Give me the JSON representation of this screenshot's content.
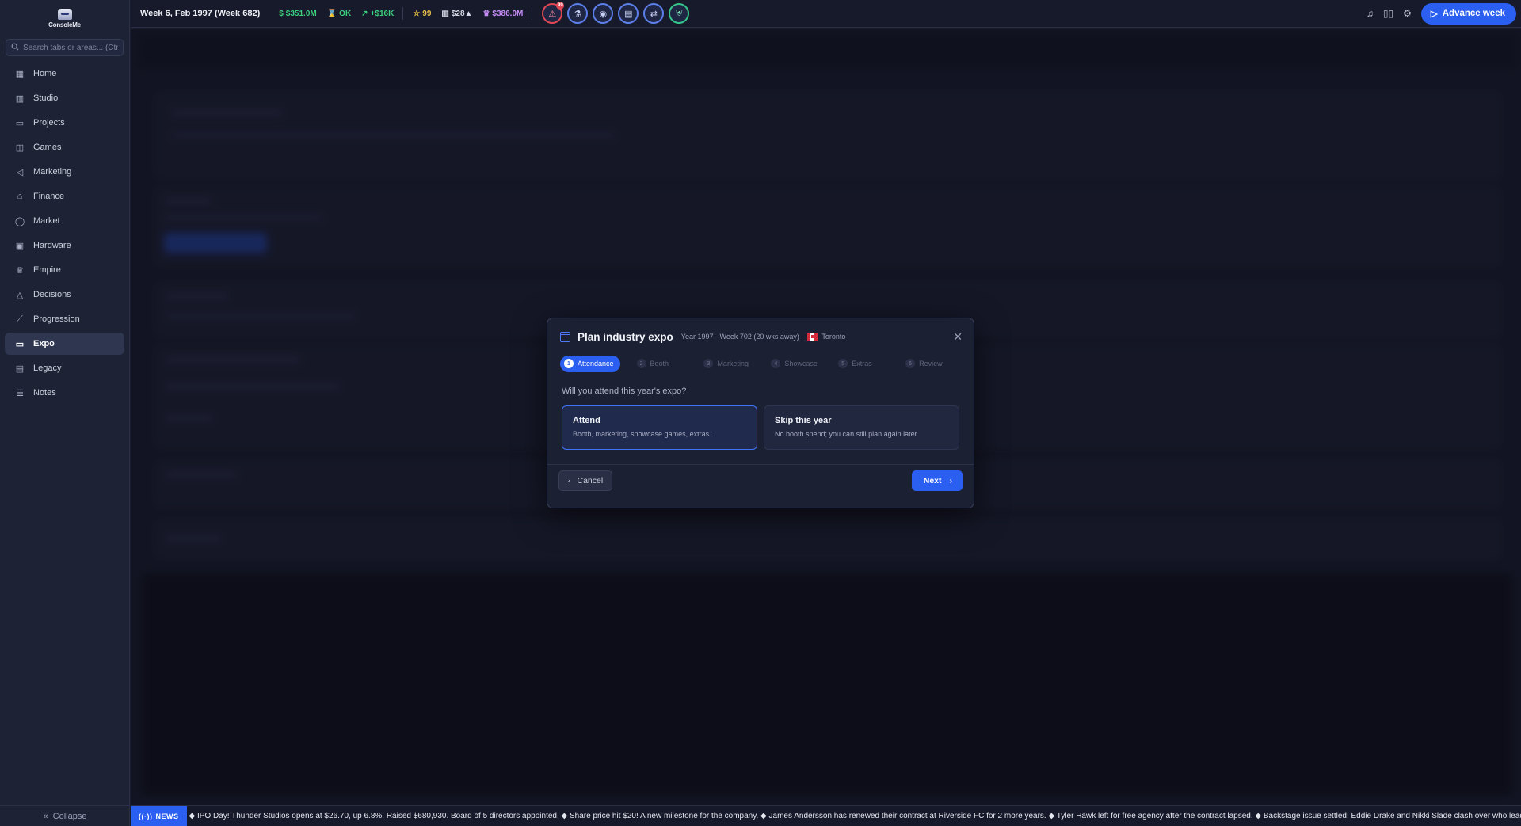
{
  "app": {
    "logo_text": "ConsoleMe"
  },
  "search": {
    "placeholder": "Search tabs or areas... (Ctrl+K)"
  },
  "sidebar": {
    "items": [
      {
        "label": "Home",
        "icon": "grid-icon"
      },
      {
        "label": "Studio",
        "icon": "building-icon"
      },
      {
        "label": "Projects",
        "icon": "folder-icon"
      },
      {
        "label": "Games",
        "icon": "gamepad-icon"
      },
      {
        "label": "Marketing",
        "icon": "megaphone-icon"
      },
      {
        "label": "Finance",
        "icon": "bank-icon"
      },
      {
        "label": "Market",
        "icon": "globe-icon"
      },
      {
        "label": "Hardware",
        "icon": "chip-icon"
      },
      {
        "label": "Empire",
        "icon": "crown-icon"
      },
      {
        "label": "Decisions",
        "icon": "triangle-icon"
      },
      {
        "label": "Progression",
        "icon": "trend-icon"
      },
      {
        "label": "Expo",
        "icon": "monitor-icon",
        "active": true
      },
      {
        "label": "Legacy",
        "icon": "book-icon"
      },
      {
        "label": "Notes",
        "icon": "notes-icon"
      }
    ],
    "collapse_label": "Collapse"
  },
  "topbar": {
    "week": "Week 6, Feb 1997 (Week 682)",
    "stats": [
      {
        "value": "$351.0M",
        "color": "#3ccf7e",
        "icon": "dollar-icon"
      },
      {
        "value": "OK",
        "color": "#3ccf7e",
        "icon": "hourglass-icon"
      },
      {
        "value": "+$16K",
        "color": "#3ccf7e",
        "icon": "trend-up-icon"
      },
      {
        "value": "99",
        "color": "#e8c14a",
        "icon": "star-icon"
      },
      {
        "value": "$28▲",
        "color": "#d7dae6",
        "icon": "chart-icon"
      },
      {
        "value": "$386.0M",
        "color": "#c58bf5",
        "icon": "crown-icon"
      }
    ],
    "alert_badge": "99",
    "advance_label": "Advance week"
  },
  "modal": {
    "title": "Plan industry expo",
    "subtitle": "Year 1997 · Week 702 (20 wks away) ·",
    "city": "Toronto",
    "steps": [
      {
        "num": "1",
        "label": "Attendance"
      },
      {
        "num": "2",
        "label": "Booth"
      },
      {
        "num": "3",
        "label": "Marketing"
      },
      {
        "num": "4",
        "label": "Showcase"
      },
      {
        "num": "5",
        "label": "Extras"
      },
      {
        "num": "6",
        "label": "Review"
      }
    ],
    "question": "Will you attend this year's expo?",
    "options": [
      {
        "title": "Attend",
        "desc": "Booth, marketing, showcase games, extras."
      },
      {
        "title": "Skip this year",
        "desc": "No booth spend; you can still plan again later."
      }
    ],
    "cancel_label": "Cancel",
    "next_label": "Next"
  },
  "news": {
    "tag": "NEWS",
    "text": "◆ IPO Day! Thunder Studios opens at $26.70, up 6.8%. Raised $680,930. Board of 5 directors appointed. ◆ Share price hit $20! A new milestone for the company. ◆ James Andersson has renewed their contract at Riverside FC for 2 more years. ◆ Tyler Hawk left for free agency after the contract lapsed. ◆ Backstage issue settled: Eddie Drake and Nikki Slade clash over who leads the brand"
  }
}
